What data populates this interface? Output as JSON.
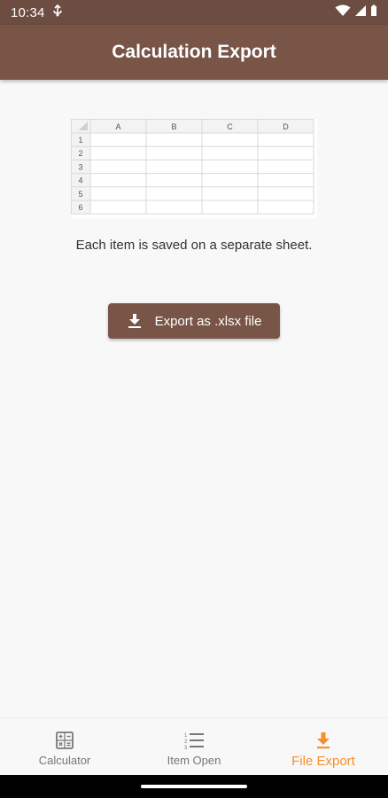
{
  "status_bar": {
    "time": "10:34"
  },
  "app_bar": {
    "title": "Calculation Export"
  },
  "sheet": {
    "columns": [
      "A",
      "B",
      "C",
      "D"
    ],
    "rows": [
      "1",
      "2",
      "3",
      "4",
      "5",
      "6"
    ]
  },
  "main": {
    "description": "Each item is saved on a separate sheet.",
    "export_button_label": "Export as .xlsx file"
  },
  "bottom_nav": {
    "items": [
      {
        "label": "Calculator",
        "icon": "calculator-icon",
        "active": false
      },
      {
        "label": "Item Open",
        "icon": "list-numbered-icon",
        "active": false
      },
      {
        "label": "File Export",
        "icon": "download-icon",
        "active": true
      }
    ]
  },
  "colors": {
    "primary": "#795548",
    "status_bar": "#6d4c41",
    "accent": "#f5902d",
    "inactive": "#777777"
  }
}
